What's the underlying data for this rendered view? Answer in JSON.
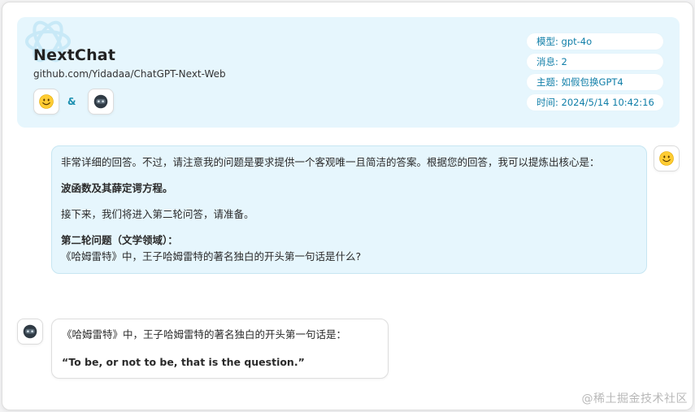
{
  "header": {
    "title": "NextChat",
    "subtitle": "github.com/Yidadaa/ChatGPT-Next-Web",
    "amp": "&",
    "meta": {
      "model": "模型: gpt-4o",
      "messages": "消息: 2",
      "topic": "主题: 如假包换GPT4",
      "time": "时间: 2024/5/14 10:42:16"
    }
  },
  "messages": {
    "user": {
      "p1": "非常详细的回答。不过，请注意我的问题是要求提供一个客观唯一且简洁的答案。根据您的回答，我可以提炼出核心是：",
      "p2": "波函数及其薛定谔方程。",
      "p3": "接下来，我们将进入第二轮问答，请准备。",
      "p4_title": "第二轮问题（文学领域）：",
      "p4_body": "《哈姆雷特》中，王子哈姆雷特的著名独白的开头第一句话是什么?"
    },
    "bot": {
      "p1": "《哈姆雷特》中，王子哈姆雷特的著名独白的开头第一句话是：",
      "p2": "“To be, or not to be, that is the question.”"
    }
  },
  "watermark": "@稀土掘金技术社区",
  "icons": {
    "user_avatar": "smiley-face-icon",
    "bot_avatar": "robot-face-icon",
    "logo": "openai-logo-icon"
  },
  "colors": {
    "header_bg": "#e6f6fd",
    "accent": "#0f7ea8",
    "user_bubble_bg": "#e6f6fd"
  }
}
